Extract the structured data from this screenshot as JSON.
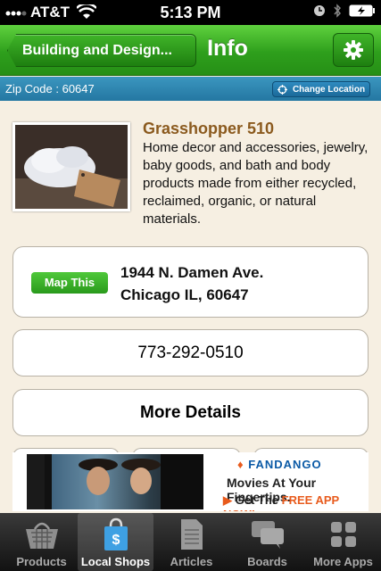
{
  "status_bar": {
    "carrier": "AT&T",
    "time": "5:13 PM"
  },
  "nav": {
    "back_label": "Building and Design...",
    "title": "Info"
  },
  "location_bar": {
    "zip": "Zip Code : 60647",
    "change_label": "Change Location"
  },
  "shop": {
    "name": "Grasshopper 510",
    "description": "Home decor and accessories, jewelry, baby goods, and bath and body products made from either recycled, reclaimed, organic, or natural materials.",
    "map_label": "Map This",
    "address_line1": "1944 N. Damen Ave.",
    "address_line2": "Chicago IL, 60647",
    "phone": "773-292-0510",
    "details_label": "More Details"
  },
  "ad": {
    "brand": "FANDANGO",
    "tagline": "Movies At Your Fingertips.",
    "cta_prefix": "Get The",
    "cta_highlight": "FREE APP NOW!"
  },
  "tabs": [
    {
      "label": "Products",
      "icon": "basket-icon"
    },
    {
      "label": "Local Shops",
      "icon": "shopping-bag-icon",
      "active": true
    },
    {
      "label": "Articles",
      "icon": "document-icon"
    },
    {
      "label": "Boards",
      "icon": "chat-bubbles-icon"
    },
    {
      "label": "More Apps",
      "icon": "grid-icon"
    }
  ],
  "colors": {
    "nav_green": "#2e9f1c",
    "zip_blue": "#2477a2",
    "shop_name": "#8b5a1e",
    "background": "#f6efe2"
  }
}
